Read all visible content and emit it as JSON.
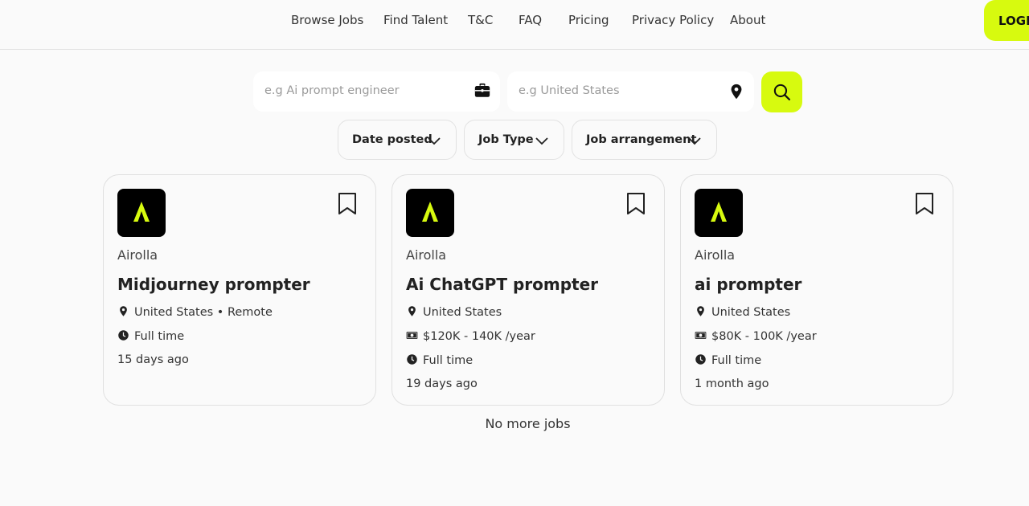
{
  "nav": {
    "links": [
      "Browse Jobs",
      "Find Talent",
      "T&C",
      "FAQ",
      "Pricing",
      "Privacy Policy",
      "About"
    ],
    "login_label": "LOGIN"
  },
  "search": {
    "job_placeholder": "e.g Ai prompt engineer",
    "location_placeholder": "e.g United States"
  },
  "filters": [
    "Date posted",
    "Job Type",
    "Job arrangement"
  ],
  "colors": {
    "accent": "#d7fa0f",
    "logo_bg": "#000000"
  },
  "jobs": [
    {
      "company": "Airolla",
      "title": "Midjourney prompter",
      "location": "United States • Remote",
      "salary": "",
      "type": "Full time",
      "posted": "15 days ago"
    },
    {
      "company": "Airolla",
      "title": "Ai ChatGPT prompter",
      "location": "United States",
      "salary": "$120K - 140K /year",
      "type": "Full time",
      "posted": "19 days ago"
    },
    {
      "company": "Airolla",
      "title": "ai prompter",
      "location": "United States",
      "salary": "$80K - 100K /year",
      "type": "Full time",
      "posted": "1 month ago"
    }
  ],
  "footer_text": "No more jobs"
}
